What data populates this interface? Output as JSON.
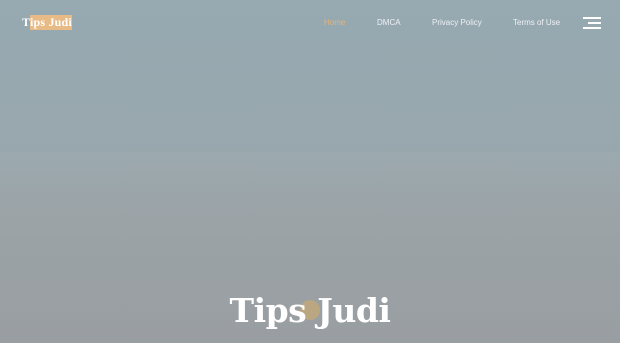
{
  "site": {
    "logo_text": "Tips Judi",
    "hero_title": "Tips Judi"
  },
  "nav": {
    "items": [
      {
        "label": "Home",
        "active": true
      },
      {
        "label": "DMCA",
        "active": false
      },
      {
        "label": "Privacy Policy",
        "active": false
      },
      {
        "label": "Terms of Use",
        "active": false
      }
    ],
    "menu_icon": "hamburger-menu-icon"
  },
  "colors": {
    "accent": "#e3b47d",
    "logo_highlight": "#e8bb86",
    "background": "#97a9b1",
    "text": "#ffffff"
  }
}
